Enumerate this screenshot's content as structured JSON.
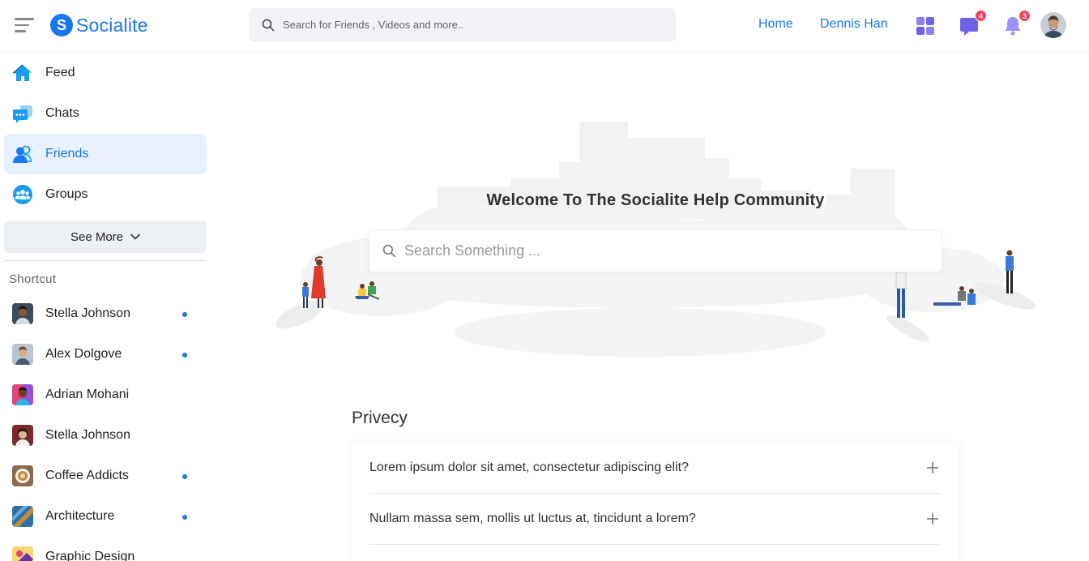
{
  "app": {
    "name": "Socialite",
    "logo_letter": "S",
    "brand_color": "#1877f2"
  },
  "header": {
    "search_placeholder": "Search for Friends , Videos and more..",
    "nav": [
      {
        "label": "Home"
      },
      {
        "label": "Dennis Han"
      }
    ],
    "icons": [
      {
        "name": "apps-grid-icon"
      },
      {
        "name": "messages-icon",
        "badge": "4"
      },
      {
        "name": "notifications-bell-icon",
        "badge": "3"
      }
    ]
  },
  "sidebar": {
    "items": [
      {
        "label": "Feed",
        "icon": "home-icon",
        "active": false
      },
      {
        "label": "Chats",
        "icon": "chat-bubble-icon",
        "active": false
      },
      {
        "label": "Friends",
        "icon": "friends-icon",
        "active": true
      },
      {
        "label": "Groups",
        "icon": "groups-icon",
        "active": false
      }
    ],
    "see_more": "See More",
    "shortcut_title": "Shortcut",
    "shortcuts": [
      {
        "label": "Stella Johnson",
        "unread": true
      },
      {
        "label": "Alex Dolgove",
        "unread": true
      },
      {
        "label": "Adrian Mohani",
        "unread": false
      },
      {
        "label": "Stella Johnson",
        "unread": false
      },
      {
        "label": "Coffee Addicts",
        "unread": true
      },
      {
        "label": "Architecture",
        "unread": true
      },
      {
        "label": "Graphic Design",
        "unread": false
      }
    ]
  },
  "main": {
    "hero_title": "Welcome To The Socialite Help Community",
    "hero_search_placeholder": "Search Something ...",
    "section_title": "Privecy",
    "faqs": [
      {
        "question": "Lorem ipsum dolor sit amet, consectetur adipiscing elit?"
      },
      {
        "question": "Nullam massa sem, mollis ut luctus at, tincidunt a lorem?"
      }
    ]
  }
}
